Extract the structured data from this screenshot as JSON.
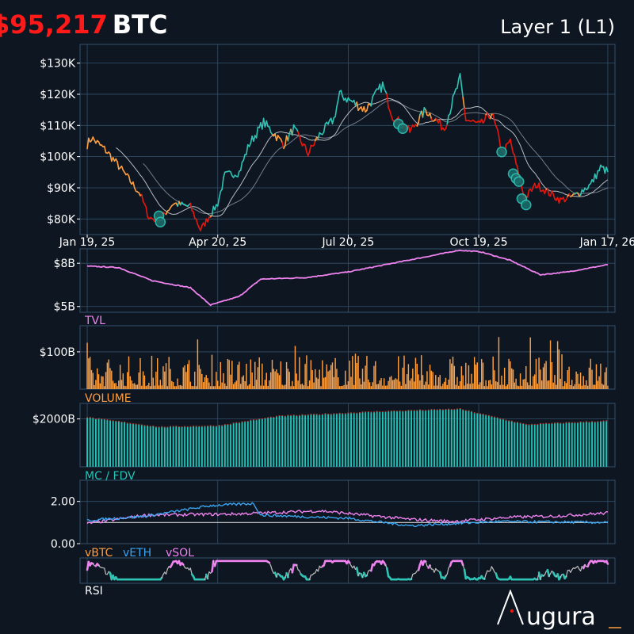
{
  "header": {
    "price": "$95,217",
    "symbol": "BTC",
    "sector": "Layer 1 (L1)"
  },
  "logo": {
    "text": "ugura"
  },
  "colors": {
    "background": "#0e1621",
    "grid": "#34506a",
    "price_up": "#2ec4b6",
    "price_down": "#e8170e",
    "price_neutral": "#ff9f40",
    "tvl": "#ee82ee",
    "volume": "#ff9f40",
    "mc_fdv": "#20c5b8",
    "vbtc": "#ff9f40",
    "veth": "#3ba5f0",
    "vsol": "#ee82ee",
    "rsi": "#bfbfbf"
  },
  "chart_data": [
    {
      "type": "line",
      "panel": "price",
      "x_range": [
        "2025-01-19",
        "2026-01-17"
      ],
      "x_tick_labels": [
        "Jan 19, 25",
        "Apr 20, 25",
        "Jul 20, 25",
        "Oct 19, 25",
        "Jan 17, 26"
      ],
      "y_tick_labels": [
        "$80K",
        "$90K",
        "$100K",
        "$110K",
        "$120K",
        "$130K"
      ],
      "ylim": [
        75000,
        136000
      ],
      "key_points": [
        {
          "x": "2025-01-19",
          "y": 104000
        },
        {
          "x": "2025-01-22",
          "y": 106000
        },
        {
          "x": "2025-02-01",
          "y": 102000
        },
        {
          "x": "2025-02-10",
          "y": 97000
        },
        {
          "x": "2025-02-25",
          "y": 88000
        },
        {
          "x": "2025-03-03",
          "y": 80500
        },
        {
          "x": "2025-03-10",
          "y": 79500
        },
        {
          "x": "2025-03-20",
          "y": 85000
        },
        {
          "x": "2025-04-01",
          "y": 84000
        },
        {
          "x": "2025-04-08",
          "y": 76500
        },
        {
          "x": "2025-04-20",
          "y": 85000
        },
        {
          "x": "2025-04-25",
          "y": 94000
        },
        {
          "x": "2025-05-05",
          "y": 95000
        },
        {
          "x": "2025-05-12",
          "y": 104000
        },
        {
          "x": "2025-05-22",
          "y": 111000
        },
        {
          "x": "2025-06-05",
          "y": 104000
        },
        {
          "x": "2025-06-12",
          "y": 109000
        },
        {
          "x": "2025-06-22",
          "y": 101000
        },
        {
          "x": "2025-06-30",
          "y": 107000
        },
        {
          "x": "2025-07-10",
          "y": 112000
        },
        {
          "x": "2025-07-14",
          "y": 120000
        },
        {
          "x": "2025-08-01",
          "y": 115000
        },
        {
          "x": "2025-08-13",
          "y": 123000
        },
        {
          "x": "2025-08-20",
          "y": 113000
        },
        {
          "x": "2025-09-01",
          "y": 108000
        },
        {
          "x": "2025-09-12",
          "y": 115000
        },
        {
          "x": "2025-09-25",
          "y": 109000
        },
        {
          "x": "2025-10-01",
          "y": 118000
        },
        {
          "x": "2025-10-06",
          "y": 125000
        },
        {
          "x": "2025-10-10",
          "y": 112000
        },
        {
          "x": "2025-10-20",
          "y": 110000
        },
        {
          "x": "2025-10-28",
          "y": 114000
        },
        {
          "x": "2025-11-05",
          "y": 101000
        },
        {
          "x": "2025-11-10",
          "y": 105000
        },
        {
          "x": "2025-11-20",
          "y": 86500
        },
        {
          "x": "2025-11-28",
          "y": 91000
        },
        {
          "x": "2025-12-05",
          "y": 89000
        },
        {
          "x": "2025-12-15",
          "y": 86000
        },
        {
          "x": "2025-12-25",
          "y": 87500
        },
        {
          "x": "2026-01-05",
          "y": 91000
        },
        {
          "x": "2026-01-12",
          "y": 96500
        },
        {
          "x": "2026-01-17",
          "y": 95217
        }
      ],
      "moving_averages": [
        "short",
        "long"
      ],
      "markers": [
        {
          "x": "2025-03-10",
          "y": 81000
        },
        {
          "x": "2025-03-11",
          "y": 79000
        },
        {
          "x": "2025-08-24",
          "y": 110500
        },
        {
          "x": "2025-08-27",
          "y": 109000
        },
        {
          "x": "2025-11-04",
          "y": 101500
        },
        {
          "x": "2025-11-12",
          "y": 94500
        },
        {
          "x": "2025-11-14",
          "y": 93000
        },
        {
          "x": "2025-11-16",
          "y": 92000
        },
        {
          "x": "2025-11-18",
          "y": 86500
        },
        {
          "x": "2025-11-21",
          "y": 84500
        }
      ]
    },
    {
      "type": "line",
      "panel": "tvl",
      "title": "TVL",
      "y_tick_labels": [
        "$5B",
        "$8B"
      ],
      "ylim": [
        4600000000,
        9000000000
      ],
      "key_points": [
        {
          "x": "2025-01-19",
          "y": 7800000000
        },
        {
          "x": "2025-02-10",
          "y": 7700000000
        },
        {
          "x": "2025-03-05",
          "y": 6800000000
        },
        {
          "x": "2025-04-01",
          "y": 6300000000
        },
        {
          "x": "2025-04-15",
          "y": 5100000000
        },
        {
          "x": "2025-05-05",
          "y": 5700000000
        },
        {
          "x": "2025-05-20",
          "y": 6900000000
        },
        {
          "x": "2025-06-20",
          "y": 7000000000
        },
        {
          "x": "2025-07-20",
          "y": 7400000000
        },
        {
          "x": "2025-08-20",
          "y": 8000000000
        },
        {
          "x": "2025-09-20",
          "y": 8600000000
        },
        {
          "x": "2025-10-05",
          "y": 8900000000
        },
        {
          "x": "2025-10-20",
          "y": 8800000000
        },
        {
          "x": "2025-11-10",
          "y": 8200000000
        },
        {
          "x": "2025-12-01",
          "y": 7200000000
        },
        {
          "x": "2025-12-20",
          "y": 7400000000
        },
        {
          "x": "2026-01-17",
          "y": 7900000000
        }
      ]
    },
    {
      "type": "bar",
      "panel": "volume",
      "title": "VOLUME",
      "y_tick_labels": [
        "$100B"
      ],
      "ylim": [
        0,
        170000000000
      ],
      "typical_value": 50000000000,
      "peak_value": 140000000000
    },
    {
      "type": "bar",
      "panel": "mc_fdv",
      "title": "MC / FDV",
      "y_tick_labels": [
        "$2000B"
      ],
      "ylim": [
        0,
        2650000000000
      ],
      "key_points": [
        {
          "x": "2025-01-19",
          "y": 2050000000000
        },
        {
          "x": "2025-03-10",
          "y": 1650000000000
        },
        {
          "x": "2025-04-20",
          "y": 1700000000000
        },
        {
          "x": "2025-06-01",
          "y": 2100000000000
        },
        {
          "x": "2025-08-13",
          "y": 2300000000000
        },
        {
          "x": "2025-10-06",
          "y": 2400000000000
        },
        {
          "x": "2025-11-21",
          "y": 1750000000000
        },
        {
          "x": "2026-01-17",
          "y": 1900000000000
        }
      ]
    },
    {
      "type": "line",
      "panel": "volatility",
      "y_tick_labels": [
        "0.00",
        "2.00"
      ],
      "ylim": [
        0,
        3
      ],
      "series": [
        {
          "name": "vBTC",
          "values_summary": "flat near 1.0"
        },
        {
          "name": "vETH",
          "key_points": [
            {
              "x": "2025-01-19",
              "y": 1.1
            },
            {
              "x": "2025-03-01",
              "y": 1.3
            },
            {
              "x": "2025-04-15",
              "y": 1.8
            },
            {
              "x": "2025-05-15",
              "y": 1.9
            },
            {
              "x": "2025-05-20",
              "y": 1.35
            },
            {
              "x": "2025-07-20",
              "y": 1.2
            },
            {
              "x": "2025-09-01",
              "y": 0.85
            },
            {
              "x": "2025-11-01",
              "y": 1.05
            },
            {
              "x": "2026-01-17",
              "y": 1.0
            }
          ]
        },
        {
          "name": "vSOL",
          "key_points": [
            {
              "x": "2025-01-19",
              "y": 0.95
            },
            {
              "x": "2025-03-01",
              "y": 1.35
            },
            {
              "x": "2025-05-01",
              "y": 1.4
            },
            {
              "x": "2025-07-01",
              "y": 1.55
            },
            {
              "x": "2025-09-01",
              "y": 1.15
            },
            {
              "x": "2025-10-01",
              "y": 1.05
            },
            {
              "x": "2025-11-10",
              "y": 1.25
            },
            {
              "x": "2025-12-10",
              "y": 1.3
            },
            {
              "x": "2026-01-17",
              "y": 1.45
            }
          ]
        }
      ]
    },
    {
      "type": "line",
      "panel": "rsi",
      "title": "RSI",
      "ylim": [
        0,
        100
      ]
    }
  ]
}
